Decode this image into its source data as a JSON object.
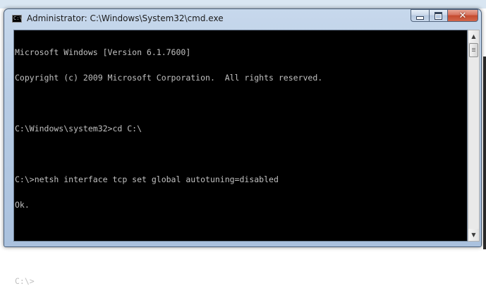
{
  "window": {
    "title": "Administrator: C:\\Windows\\System32\\cmd.exe",
    "app_icon_text": "C:\\",
    "icon": "cmd-icon"
  },
  "caption_buttons": {
    "minimize": "minimize-icon",
    "maximize": "maximize-icon",
    "close": "close-icon",
    "close_glyph": "✕"
  },
  "console": {
    "lines": [
      "Microsoft Windows [Version 6.1.7600]",
      "Copyright (c) 2009 Microsoft Corporation.  All rights reserved.",
      "",
      "C:\\Windows\\system32>cd C:\\",
      "",
      "C:\\>netsh interface tcp set global autotuning=disabled",
      "Ok.",
      "",
      "",
      "C:\\>"
    ]
  },
  "scrollbar": {
    "up_glyph": "▲",
    "down_glyph": "▼",
    "position_fraction": 0.0
  },
  "colors": {
    "console_background": "#000000",
    "console_text": "#c0c0c0",
    "close_button": "#c44b2f",
    "frame": "#b6cbe4"
  }
}
